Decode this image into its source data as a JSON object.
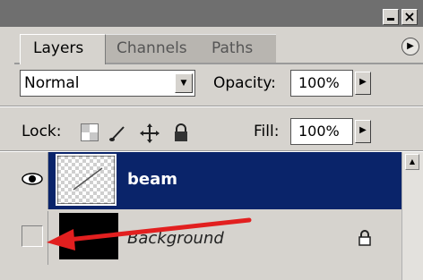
{
  "tabs": [
    {
      "label": "Layers"
    },
    {
      "label": "Channels"
    },
    {
      "label": "Paths"
    }
  ],
  "blend_mode": {
    "value": "Normal"
  },
  "opacity": {
    "label": "Opacity:",
    "value": "100%"
  },
  "lock": {
    "label": "Lock:"
  },
  "fill": {
    "label": "Fill:",
    "value": "100%"
  },
  "layers": [
    {
      "name": "beam",
      "selected": true,
      "visible": true
    },
    {
      "name": "Background",
      "selected": false,
      "visible": false,
      "locked": true
    }
  ],
  "colors": {
    "selection": "#0a246a",
    "annotation_arrow": "#e21f1f",
    "panel": "#d6d3ce"
  },
  "icons": [
    "minimize-icon",
    "close-icon",
    "panel-menu-icon",
    "dropdown-arrow-icon",
    "step-arrow-icon",
    "lock-transparency-icon",
    "brush-icon",
    "move-icon",
    "padlock-icon",
    "eye-icon",
    "layer-lock-icon",
    "annotation-arrow"
  ]
}
